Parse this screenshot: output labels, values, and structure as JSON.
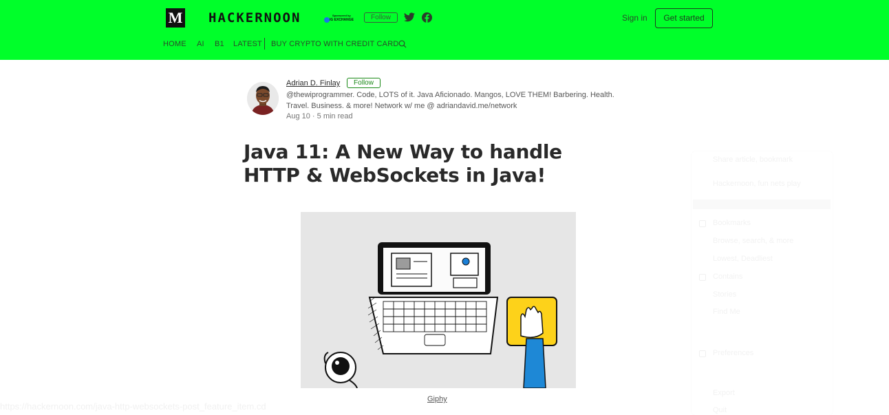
{
  "header": {
    "logo_letter": "M",
    "brand": "HACKERNOON",
    "sponsor_line1": "Sponsored by",
    "sponsor_line2": "IG EXCHANGE",
    "follow_label": "Follow",
    "signin_label": "Sign in",
    "get_started_label": "Get started",
    "nav": [
      "HOME",
      "AI",
      "B1",
      "LATEST",
      "BUY CRYPTO WITH CREDIT CARD"
    ],
    "accent_color": "#00ff2a"
  },
  "author": {
    "name": "Adrian D. Finlay",
    "follow_label": "Follow",
    "bio": "@thewiprogrammer. Code, LOTS of it. Java Aficionado. Mangos, LOVE THEM! Barbering. Health. Travel. Business. & more! Network w/ me @ adriandavid.me/network",
    "meta": "Aug 10 · 5 min read"
  },
  "article": {
    "title": "Java 11: A New Way to handle HTTP & WebSockets in Java!",
    "image_caption": "Giphy"
  },
  "sidebar": {
    "items": [
      "Share article, bookmark",
      "Hackernoon, fun nets play",
      "Bookmarks",
      "Browse, search, & more",
      "Lowest, Deadliest",
      "Contains",
      "Stories",
      "Find Me",
      "Preferences",
      "Export",
      "Quit"
    ]
  },
  "status_bar": {
    "url": "https://hackernoon.com/java-http-websockets-post_feature_item.cd"
  }
}
